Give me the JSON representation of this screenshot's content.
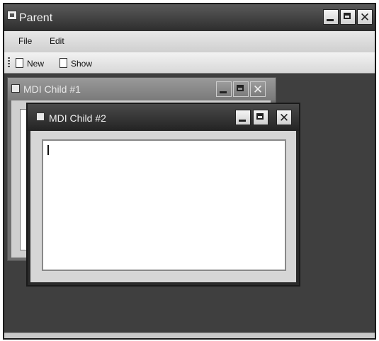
{
  "parent": {
    "title": "Parent",
    "menu": [
      "File",
      "Edit"
    ],
    "toolbar": {
      "new_label": "New",
      "show_label": "Show"
    }
  },
  "children": [
    {
      "title": "MDI Child #1"
    },
    {
      "title": "MDI Child #2"
    }
  ],
  "colors": {
    "titlebar_active": "#2d2d2d",
    "mdi_background": "#3f3f3f",
    "control_face": "#d6d6d6"
  },
  "icons": [
    "app-icon",
    "minimize-icon",
    "maximize-icon",
    "close-icon",
    "new-document-icon",
    "show-window-icon"
  ]
}
